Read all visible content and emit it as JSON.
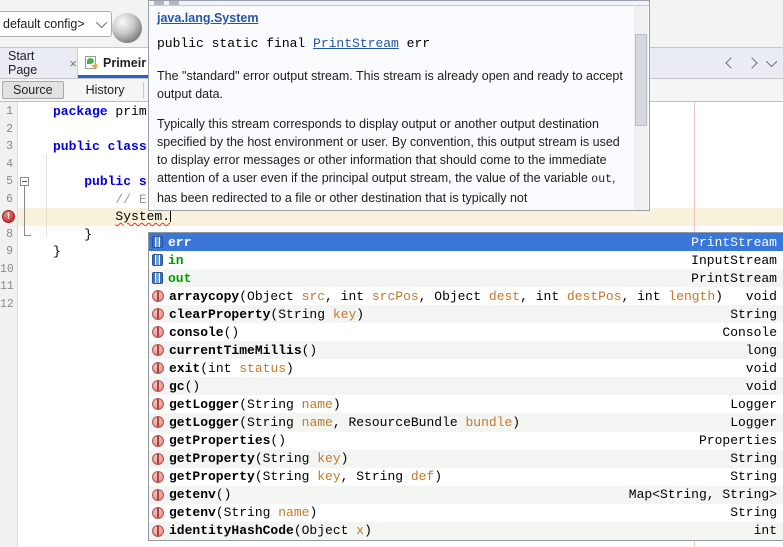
{
  "colors": {
    "kw": "#0000E6",
    "comment": "#9A9A9A",
    "link": "#2456A8",
    "selection": "#3B76D9",
    "green": "#00A000",
    "param": "#C4782A",
    "currentline": "#F8F1DC",
    "error": "#DD3B3B",
    "margin": "#EDC2CB",
    "tabaccent": "#2A62C9"
  },
  "top_toolbar": {
    "config_dropdown": "default config>"
  },
  "tab_bar": {
    "tabs": [
      {
        "label": "Start Page",
        "close": "×"
      },
      {
        "label": "Primeir"
      }
    ]
  },
  "editor_toolbar": {
    "source": "Source",
    "history": "History"
  },
  "doc_popup": {
    "class_link": "java.lang.System",
    "sig_prefix": "public static final ",
    "sig_type_link": "PrintStream",
    "sig_suffix": " err",
    "para1": "The \"standard\" error output stream. This stream is already open and ready to accept output data.",
    "para2_before": "Typically this stream corresponds to display output or another output destination specified by the host environment or user. By convention, this output stream is used to display error messages or other information that should come to the immediate attention of a user even if the principal output stream, the value of the variable ",
    "para2_code": "out",
    "para2_after": ", has been redirected to a file or other destination that is typically not"
  },
  "editor": {
    "error_badge": "!",
    "lines": [
      {
        "n": "1",
        "tokens": [
          [
            "kw",
            "package "
          ],
          [
            "pl",
            "prim"
          ]
        ]
      },
      {
        "n": "2",
        "tokens": []
      },
      {
        "n": "3",
        "tokens": [
          [
            "kw",
            "public class"
          ]
        ]
      },
      {
        "n": "4",
        "tokens": []
      },
      {
        "n": "5",
        "tokens": [
          [
            "pl",
            "    "
          ],
          [
            "kw",
            "public s"
          ]
        ]
      },
      {
        "n": "6",
        "tokens": [
          [
            "pl",
            "        "
          ],
          [
            "cm",
            "// E"
          ]
        ]
      },
      {
        "n": "7",
        "tokens": [
          [
            "pl",
            "        "
          ],
          [
            "err",
            "System."
          ]
        ],
        "error": true,
        "cursor": true
      },
      {
        "n": "8",
        "tokens": [
          [
            "pl",
            "    }"
          ]
        ]
      },
      {
        "n": "9",
        "tokens": [
          [
            "pl",
            "}"
          ]
        ]
      },
      {
        "n": "10",
        "tokens": []
      },
      {
        "n": "11",
        "tokens": []
      },
      {
        "n": "12",
        "tokens": []
      }
    ]
  },
  "completion": {
    "items": [
      {
        "kind": "field",
        "name": "err",
        "sig": [],
        "type": "PrintStream",
        "selected": true
      },
      {
        "kind": "field",
        "name": "in",
        "green": true,
        "sig": [],
        "type": "InputStream"
      },
      {
        "kind": "field",
        "name": "out",
        "green": true,
        "sig": [],
        "type": "PrintStream"
      },
      {
        "kind": "method",
        "name": "arraycopy",
        "sig": [
          [
            "pl",
            "(Object "
          ],
          [
            "pm",
            "src"
          ],
          [
            "pl",
            ", int "
          ],
          [
            "pm",
            "srcPos"
          ],
          [
            "pl",
            ", Object "
          ],
          [
            "pm",
            "dest"
          ],
          [
            "pl",
            ", int "
          ],
          [
            "pm",
            "destPos"
          ],
          [
            "pl",
            ", int "
          ],
          [
            "pm",
            "length"
          ],
          [
            "pl",
            ")"
          ]
        ],
        "type": "void"
      },
      {
        "kind": "method",
        "name": "clearProperty",
        "sig": [
          [
            "pl",
            "(String "
          ],
          [
            "pm",
            "key"
          ],
          [
            "pl",
            ")"
          ]
        ],
        "type": "String"
      },
      {
        "kind": "method",
        "name": "console",
        "sig": [
          [
            "pl",
            "()"
          ]
        ],
        "type": "Console"
      },
      {
        "kind": "method",
        "name": "currentTimeMillis",
        "sig": [
          [
            "pl",
            "()"
          ]
        ],
        "type": "long"
      },
      {
        "kind": "method",
        "name": "exit",
        "sig": [
          [
            "pl",
            "(int "
          ],
          [
            "pm",
            "status"
          ],
          [
            "pl",
            ")"
          ]
        ],
        "type": "void"
      },
      {
        "kind": "method",
        "name": "gc",
        "sig": [
          [
            "pl",
            "()"
          ]
        ],
        "type": "void"
      },
      {
        "kind": "method",
        "name": "getLogger",
        "sig": [
          [
            "pl",
            "(String "
          ],
          [
            "pm",
            "name"
          ],
          [
            "pl",
            ")"
          ]
        ],
        "type": "Logger"
      },
      {
        "kind": "method",
        "name": "getLogger",
        "sig": [
          [
            "pl",
            "(String "
          ],
          [
            "pm",
            "name"
          ],
          [
            "pl",
            ", ResourceBundle "
          ],
          [
            "pm",
            "bundle"
          ],
          [
            "pl",
            ")"
          ]
        ],
        "type": "Logger"
      },
      {
        "kind": "method",
        "name": "getProperties",
        "sig": [
          [
            "pl",
            "()"
          ]
        ],
        "type": "Properties"
      },
      {
        "kind": "method",
        "name": "getProperty",
        "sig": [
          [
            "pl",
            "(String "
          ],
          [
            "pm",
            "key"
          ],
          [
            "pl",
            ")"
          ]
        ],
        "type": "String"
      },
      {
        "kind": "method",
        "name": "getProperty",
        "sig": [
          [
            "pl",
            "(String "
          ],
          [
            "pm",
            "key"
          ],
          [
            "pl",
            ", String "
          ],
          [
            "pm",
            "def"
          ],
          [
            "pl",
            ")"
          ]
        ],
        "type": "String"
      },
      {
        "kind": "method",
        "name": "getenv",
        "sig": [
          [
            "pl",
            "()"
          ]
        ],
        "type": "Map<String, String>"
      },
      {
        "kind": "method",
        "name": "getenv",
        "sig": [
          [
            "pl",
            "(String "
          ],
          [
            "pm",
            "name"
          ],
          [
            "pl",
            ")"
          ]
        ],
        "type": "String"
      },
      {
        "kind": "method",
        "name": "identityHashCode",
        "sig": [
          [
            "pl",
            "(Object "
          ],
          [
            "pm",
            "x"
          ],
          [
            "pl",
            ")"
          ]
        ],
        "type": "int"
      }
    ]
  }
}
